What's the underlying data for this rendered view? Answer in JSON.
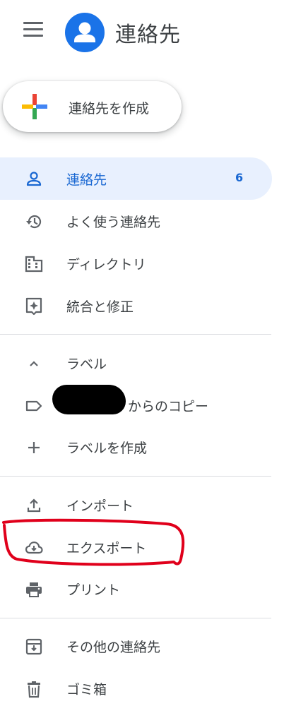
{
  "header": {
    "title": "連絡先"
  },
  "create_button": {
    "label": "連絡先を作成"
  },
  "nav": {
    "contacts": {
      "label": "連絡先",
      "count": "6"
    },
    "frequent": {
      "label": "よく使う連絡先"
    },
    "directory": {
      "label": "ディレクトリ"
    },
    "merge": {
      "label": "統合と修正"
    }
  },
  "labels": {
    "header": "ラベル",
    "copy_item": "からのコピー",
    "create": "ラベルを作成"
  },
  "actions": {
    "import": "インポート",
    "export": "エクスポート",
    "print": "プリント"
  },
  "other": {
    "other_contacts": "その他の連絡先",
    "trash": "ゴミ箱"
  },
  "colors": {
    "accent": "#1a73e8",
    "active_bg": "#e8f0fe",
    "active_text": "#1967d2",
    "icon": "#5f6368",
    "annotation": "#e0001b"
  }
}
